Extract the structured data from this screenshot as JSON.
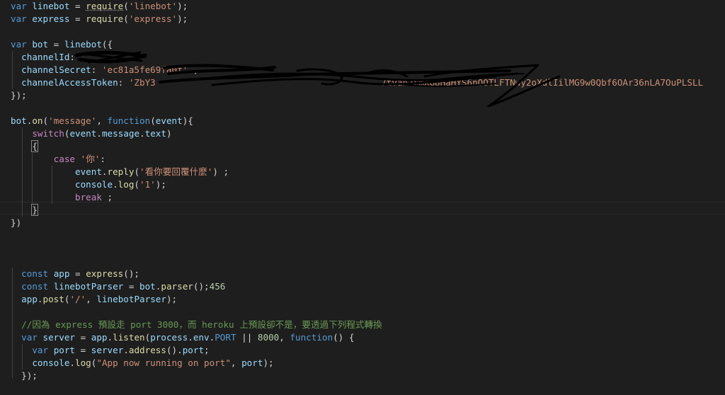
{
  "editor": {
    "lines": [
      {
        "id": "l1",
        "tokens": [
          [
            "kw",
            "var"
          ],
          [
            "punc",
            " "
          ],
          [
            "var",
            "linebot"
          ],
          [
            "punc",
            " = "
          ],
          [
            "fn",
            "require",
            "squiggle"
          ],
          [
            "punc",
            "("
          ],
          [
            "str",
            "'linebot'"
          ],
          [
            "punc",
            ");"
          ]
        ]
      },
      {
        "id": "l2",
        "tokens": [
          [
            "kw",
            "var"
          ],
          [
            "punc",
            " "
          ],
          [
            "var",
            "express"
          ],
          [
            "punc",
            " = "
          ],
          [
            "fn",
            "require"
          ],
          [
            "punc",
            "("
          ],
          [
            "str",
            "'express'"
          ],
          [
            "punc",
            ");"
          ]
        ]
      },
      {
        "id": "l3",
        "tokens": []
      },
      {
        "id": "l4",
        "tokens": [
          [
            "kw",
            "var"
          ],
          [
            "punc",
            " "
          ],
          [
            "var",
            "bot"
          ],
          [
            "punc",
            " = "
          ],
          [
            "var",
            "linebot"
          ],
          [
            "punc",
            "({"
          ]
        ]
      },
      {
        "id": "l5",
        "tokens": [
          [
            "punc",
            "  "
          ],
          [
            "var",
            "channelId"
          ],
          [
            "punc",
            ": "
          ],
          [
            "str",
            "'"
          ]
        ]
      },
      {
        "id": "l6",
        "tokens": [
          [
            "punc",
            "  "
          ],
          [
            "var",
            "channelSecret"
          ],
          [
            "punc",
            ": "
          ],
          [
            "str",
            "'ec81a5fe69fa0f'"
          ],
          [
            "punc",
            " ,"
          ]
        ]
      },
      {
        "id": "l7",
        "tokens": [
          [
            "punc",
            "  "
          ],
          [
            "var",
            "channelAccessToken"
          ],
          [
            "punc",
            ": "
          ],
          [
            "str",
            "'ZbY3"
          ],
          [
            "punc",
            "                                          "
          ],
          [
            "str",
            "7tvan2cmXG8HaHYS6nOOTLFTNwy2oXdlIilMG9w0Qbf6OAr36nLA7OuPLSLL"
          ]
        ]
      },
      {
        "id": "l8",
        "tokens": [
          [
            "punc",
            "});"
          ]
        ]
      },
      {
        "id": "l9",
        "tokens": []
      },
      {
        "id": "l10",
        "tokens": [
          [
            "var",
            "bot"
          ],
          [
            "punc",
            "."
          ],
          [
            "fn",
            "on"
          ],
          [
            "punc",
            "("
          ],
          [
            "str",
            "'message'"
          ],
          [
            "punc",
            ", "
          ],
          [
            "kw",
            "function"
          ],
          [
            "punc",
            "("
          ],
          [
            "var",
            "event"
          ],
          [
            "punc",
            "){"
          ]
        ]
      },
      {
        "id": "l11",
        "tokens": [
          [
            "punc",
            "    "
          ],
          [
            "ctl",
            "switch"
          ],
          [
            "punc",
            "("
          ],
          [
            "var",
            "event"
          ],
          [
            "punc",
            "."
          ],
          [
            "var",
            "message"
          ],
          [
            "punc",
            "."
          ],
          [
            "var",
            "text"
          ],
          [
            "punc",
            ")"
          ]
        ]
      },
      {
        "id": "l12",
        "tokens": [
          [
            "punc",
            "    "
          ],
          [
            "punc",
            "{",
            "bracket-box"
          ]
        ]
      },
      {
        "id": "l13",
        "tokens": [
          [
            "punc",
            "        "
          ],
          [
            "ctl",
            "case"
          ],
          [
            "punc",
            " "
          ],
          [
            "str",
            "'你'"
          ],
          [
            "punc",
            ":"
          ]
        ]
      },
      {
        "id": "l14",
        "tokens": [
          [
            "punc",
            "            "
          ],
          [
            "var",
            "event"
          ],
          [
            "punc",
            "."
          ],
          [
            "fn",
            "reply"
          ],
          [
            "punc",
            "("
          ],
          [
            "str",
            "'看你要回覆什麼'"
          ],
          [
            "punc",
            ") ;"
          ]
        ]
      },
      {
        "id": "l15",
        "tokens": [
          [
            "punc",
            "            "
          ],
          [
            "var",
            "console"
          ],
          [
            "punc",
            "."
          ],
          [
            "fn",
            "log"
          ],
          [
            "punc",
            "("
          ],
          [
            "str",
            "'1'"
          ],
          [
            "punc",
            ");"
          ]
        ]
      },
      {
        "id": "l16",
        "tokens": [
          [
            "punc",
            "            "
          ],
          [
            "ctl",
            "break"
          ],
          [
            "punc",
            " ;"
          ]
        ]
      },
      {
        "id": "l17",
        "tokens": [
          [
            "punc",
            "    "
          ],
          [
            "punc",
            "}",
            "bracket-box"
          ]
        ]
      },
      {
        "id": "l18",
        "tokens": [
          [
            "punc",
            "})"
          ]
        ]
      },
      {
        "id": "l19",
        "tokens": []
      },
      {
        "id": "l20",
        "tokens": []
      },
      {
        "id": "l21",
        "tokens": []
      },
      {
        "id": "l22",
        "tokens": [
          [
            "punc",
            "  "
          ],
          [
            "kw",
            "const"
          ],
          [
            "punc",
            " "
          ],
          [
            "var",
            "app"
          ],
          [
            "punc",
            " = "
          ],
          [
            "fn",
            "express"
          ],
          [
            "punc",
            "();"
          ]
        ]
      },
      {
        "id": "l23",
        "tokens": [
          [
            "punc",
            "  "
          ],
          [
            "kw",
            "const"
          ],
          [
            "punc",
            " "
          ],
          [
            "var",
            "linebotParser"
          ],
          [
            "punc",
            " = "
          ],
          [
            "var",
            "bot"
          ],
          [
            "punc",
            "."
          ],
          [
            "fn",
            "parser"
          ],
          [
            "punc",
            "();"
          ],
          [
            "num",
            "456"
          ]
        ]
      },
      {
        "id": "l24",
        "tokens": [
          [
            "punc",
            "  "
          ],
          [
            "var",
            "app"
          ],
          [
            "punc",
            "."
          ],
          [
            "fn",
            "post"
          ],
          [
            "punc",
            "("
          ],
          [
            "str",
            "'/'"
          ],
          [
            "punc",
            ", "
          ],
          [
            "var",
            "linebotParser"
          ],
          [
            "punc",
            ");"
          ]
        ]
      },
      {
        "id": "l25",
        "tokens": []
      },
      {
        "id": "l26",
        "tokens": [
          [
            "punc",
            "  "
          ],
          [
            "cmt",
            "//因為 express 預設走 port 3000，而 heroku 上預設卻不是，要透過下列程式轉換"
          ]
        ]
      },
      {
        "id": "l27",
        "tokens": [
          [
            "punc",
            "  "
          ],
          [
            "kw",
            "var"
          ],
          [
            "punc",
            " "
          ],
          [
            "var",
            "server"
          ],
          [
            "punc",
            " = "
          ],
          [
            "var",
            "app"
          ],
          [
            "punc",
            "."
          ],
          [
            "fn",
            "listen"
          ],
          [
            "punc",
            "("
          ],
          [
            "var",
            "process"
          ],
          [
            "punc",
            "."
          ],
          [
            "var",
            "env"
          ],
          [
            "punc",
            "."
          ],
          [
            "kw",
            "PORT"
          ],
          [
            "punc",
            " || "
          ],
          [
            "num",
            "8000"
          ],
          [
            "punc",
            ", "
          ],
          [
            "kw",
            "function"
          ],
          [
            "punc",
            "() {"
          ]
        ]
      },
      {
        "id": "l28",
        "tokens": [
          [
            "punc",
            "    "
          ],
          [
            "kw",
            "var"
          ],
          [
            "punc",
            " "
          ],
          [
            "var",
            "port"
          ],
          [
            "punc",
            " = "
          ],
          [
            "var",
            "server"
          ],
          [
            "punc",
            "."
          ],
          [
            "fn",
            "address"
          ],
          [
            "punc",
            "()."
          ],
          [
            "var",
            "port"
          ],
          [
            "punc",
            ";"
          ]
        ]
      },
      {
        "id": "l29",
        "tokens": [
          [
            "punc",
            "    "
          ],
          [
            "var",
            "console"
          ],
          [
            "punc",
            "."
          ],
          [
            "fn",
            "log"
          ],
          [
            "punc",
            "("
          ],
          [
            "str",
            "\"App now running on port\""
          ],
          [
            "punc",
            ", "
          ],
          [
            "var",
            "port"
          ],
          [
            "punc",
            ");"
          ]
        ]
      },
      {
        "id": "l30",
        "tokens": [
          [
            "punc",
            "  "
          ],
          [
            "punc",
            "});"
          ]
        ]
      }
    ]
  }
}
